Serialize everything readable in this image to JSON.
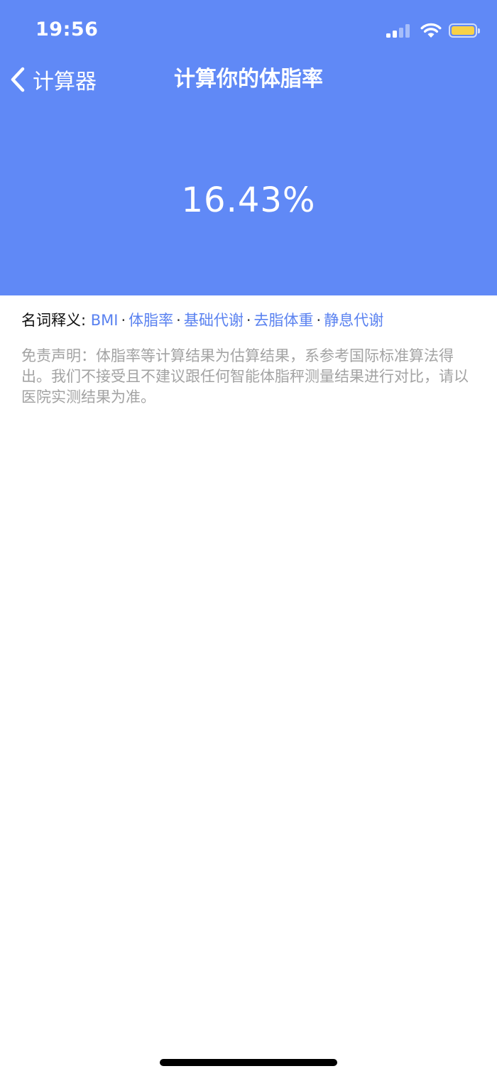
{
  "status_bar": {
    "time": "19:56"
  },
  "nav": {
    "back_label": "计算器",
    "title": "计算你的体脂率"
  },
  "result": {
    "value": "16.43%"
  },
  "glossary": {
    "prefix": "名词释义:",
    "separator": "·",
    "terms": [
      "BMI",
      "体脂率",
      "基础代谢",
      "去脂体重",
      "静息代谢"
    ]
  },
  "disclaimer": {
    "text": "免责声明：体脂率等计算结果为估算结果，系参考国际标准算法得出。我们不接受且不建议跟任何智能体脂秤测量结果进行对比，请以医院实测结果为准。"
  },
  "colors": {
    "accent": "#6089f6",
    "link": "#5a82f0",
    "battery": "#f7d148",
    "muted_text": "#a3a3a3"
  },
  "icons": [
    "signal-icon",
    "wifi-icon",
    "battery-icon",
    "back-chevron-icon"
  ]
}
